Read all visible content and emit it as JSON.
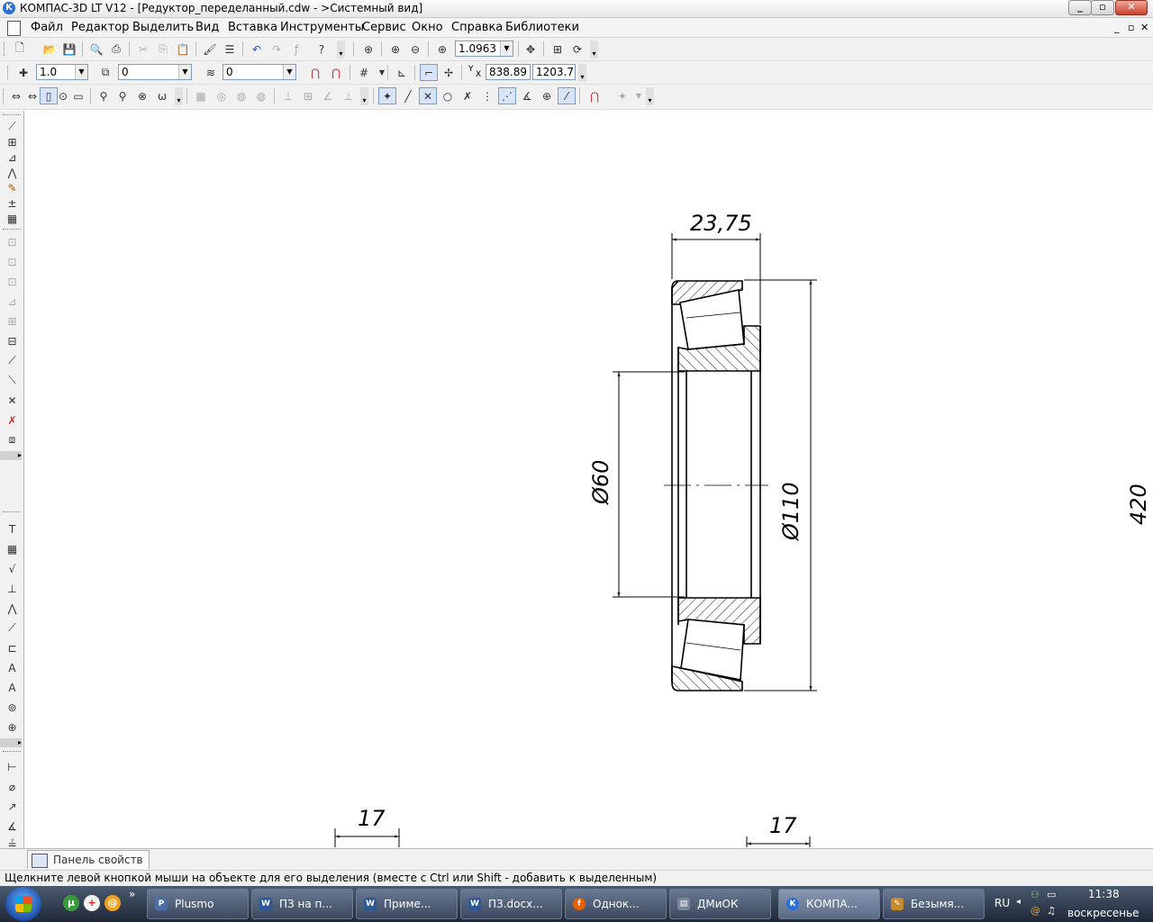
{
  "window": {
    "title": "КОМПАС-3D LT V12 - [Редуктор_переделанный.cdw - >Системный вид]",
    "logo_letter": "K",
    "minimize_symbol": "_",
    "restore_symbol": "▫",
    "close_symbol": "✕"
  },
  "menu": {
    "items": [
      "Файл",
      "Редактор",
      "Выделить",
      "Вид",
      "Вставка",
      "Инструменты",
      "Сервис",
      "Окно",
      "Справка",
      "Библиотеки"
    ],
    "mdi_controls": [
      "_",
      "▫",
      "✕"
    ]
  },
  "toolbar_standard": {
    "zoom_value": "1.0963"
  },
  "toolbar_current_state": {
    "step_value": "1.0",
    "layer_value": "0",
    "style_value": "0",
    "coord_x": "838.89",
    "coord_y": "1203.7",
    "coord_label_y": "Y",
    "coord_label_x": "X"
  },
  "drawing": {
    "dimensions": {
      "width_top": "23,75",
      "inner_diameter": "Ø60",
      "outer_diameter": "Ø110",
      "right_edge": "420",
      "bottom_left": "17",
      "bottom_right": "17"
    }
  },
  "property_panel": {
    "tab_label": "Панель свойств"
  },
  "status": {
    "hint": "Щелкните левой кнопкой мыши на объекте для его выделения (вместе с Ctrl или Shift - добавить к выделенным)"
  },
  "taskbar": {
    "quicklaunch_more": "»",
    "tasks": [
      {
        "label": "Plusmo",
        "icon": "plusmo-icon",
        "color": "#4a6fa5"
      },
      {
        "label": "ПЗ на п...",
        "icon": "word-icon",
        "color": "#2b5797"
      },
      {
        "label": "Приме...",
        "icon": "word-icon",
        "color": "#2b5797"
      },
      {
        "label": "ПЗ.docx...",
        "icon": "word-icon",
        "color": "#2b5797"
      },
      {
        "label": "Однок...",
        "icon": "firefox-icon",
        "color": "#e66000"
      },
      {
        "label": "ДМиОК",
        "icon": "folder-icon",
        "color": "#7a8699"
      },
      {
        "label": "КОМПА...",
        "icon": "kompas-icon",
        "color": "#2a6fd6"
      },
      {
        "label": "Безымя...",
        "icon": "paint-icon",
        "color": "#c58a2a"
      }
    ],
    "language": "RU",
    "clock_time": "11:38",
    "clock_day": "воскресенье"
  }
}
